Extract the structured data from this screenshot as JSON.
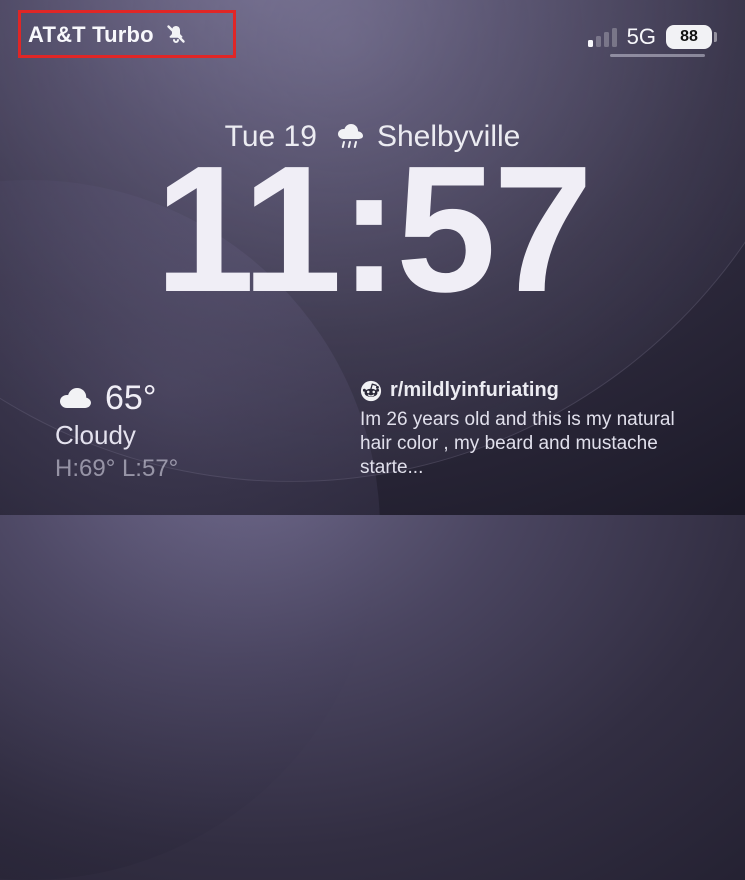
{
  "status": {
    "carrier": "AT&T Turbo",
    "silent_mode": true,
    "network_type": "5G",
    "battery_percent": "88"
  },
  "lockscreen": {
    "date": "Tue 19",
    "location": "Shelbyville",
    "time": "11:57"
  },
  "weather": {
    "temp": "65°",
    "condition": "Cloudy",
    "high_low": "H:69° L:57°"
  },
  "notification": {
    "app_icon": "reddit-icon",
    "title": "r/mildlyinfuriating",
    "body": "Im 26 years old and this is my natural hair color , my beard and mustache starte..."
  }
}
